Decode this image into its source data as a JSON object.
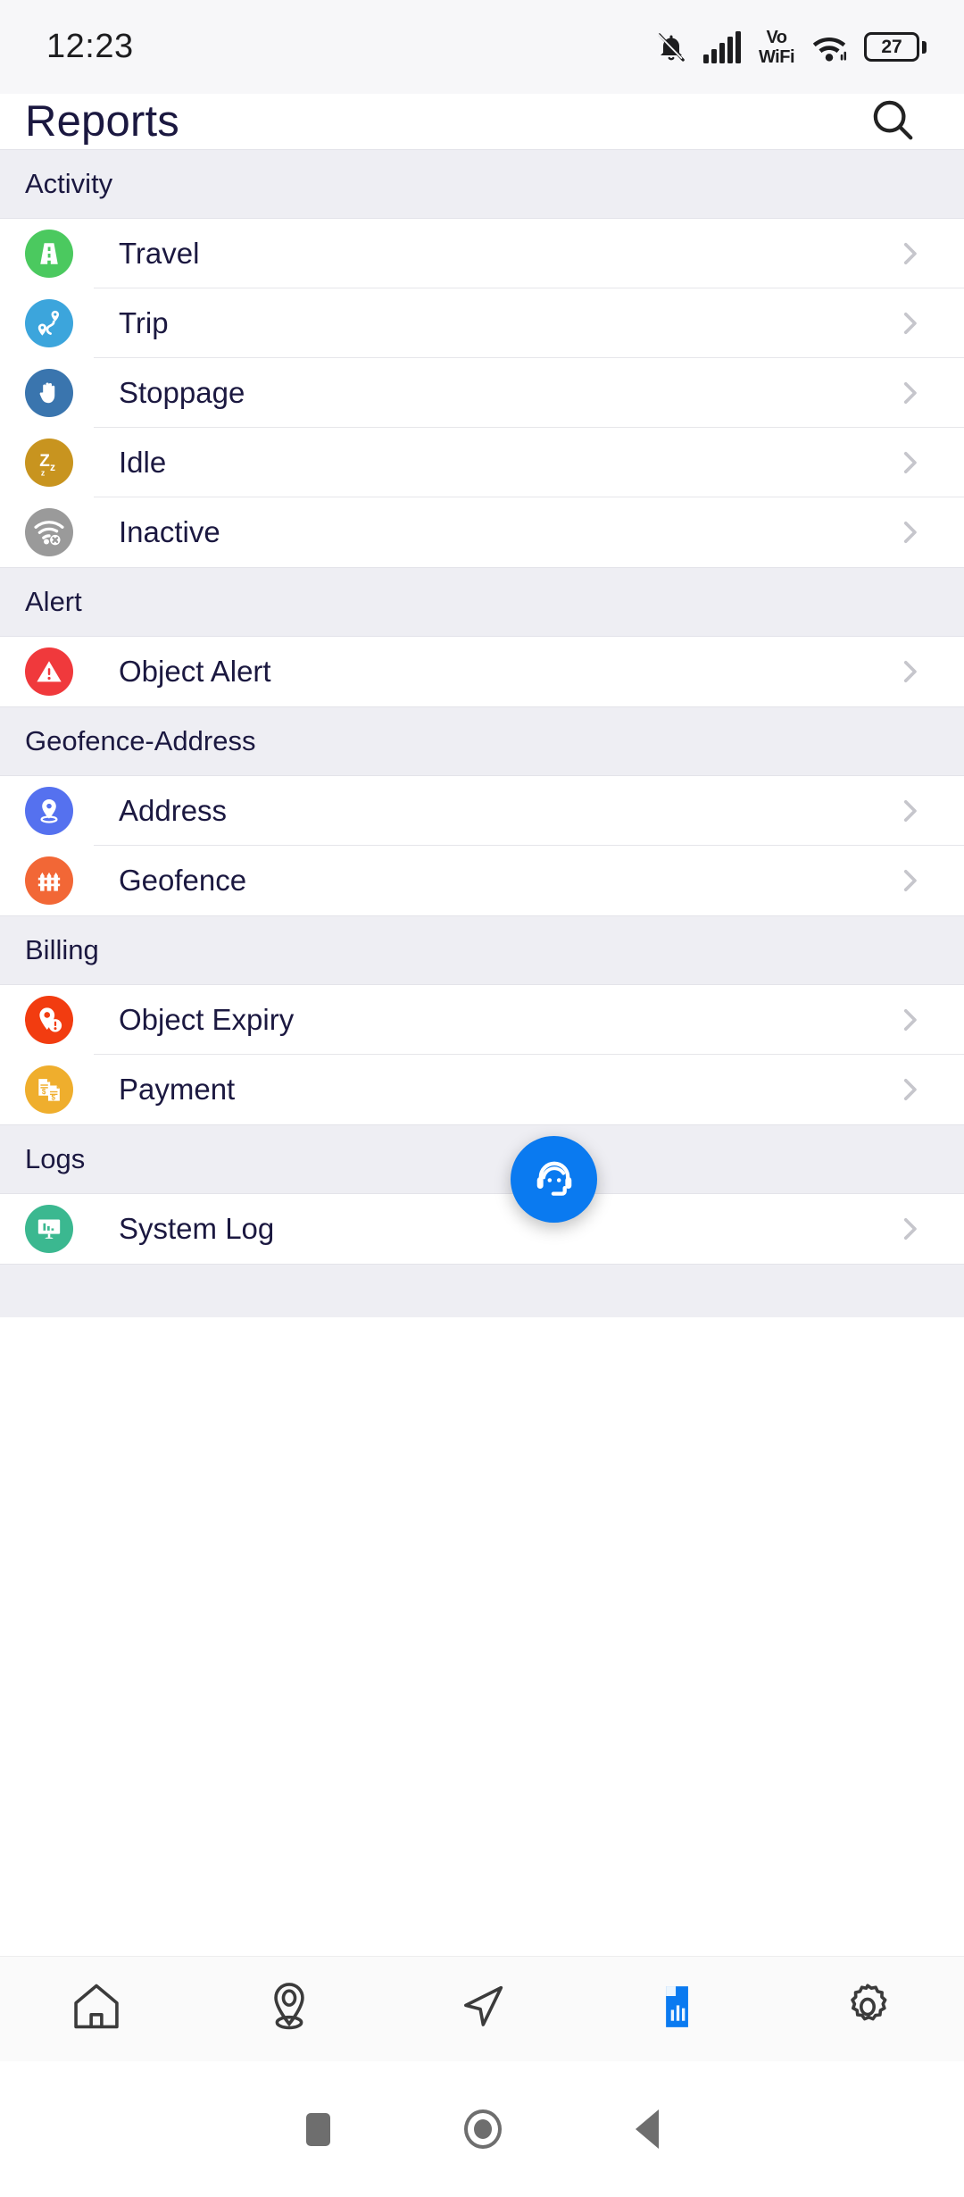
{
  "status_bar": {
    "time": "12:23",
    "vowifi_top": "Vo",
    "vowifi_bottom": "WiFi",
    "battery_level": "27",
    "icons": [
      "bell-muted-icon",
      "signal-bars-icon",
      "vowifi-icon",
      "wifi-icon",
      "battery-icon"
    ]
  },
  "app_bar": {
    "title": "Reports",
    "search_icon": "search-icon"
  },
  "sections": [
    {
      "title": "Activity",
      "items": [
        {
          "label": "Travel",
          "icon": "road-icon",
          "color": "#4bc95f"
        },
        {
          "label": "Trip",
          "icon": "route-pins-icon",
          "color": "#3ca5dc"
        },
        {
          "label": "Stoppage",
          "icon": "hand-stop-icon",
          "color": "#3a75ae"
        },
        {
          "label": "Idle",
          "icon": "sleep-zzz-icon",
          "color": "#c8941f"
        },
        {
          "label": "Inactive",
          "icon": "wifi-off-icon",
          "color": "#9a9a9a"
        }
      ]
    },
    {
      "title": "Alert",
      "items": [
        {
          "label": "Object Alert",
          "icon": "warning-triangle-icon",
          "color": "#f0393c"
        }
      ]
    },
    {
      "title": "Geofence-Address",
      "items": [
        {
          "label": "Address",
          "icon": "map-pin-icon",
          "color": "#5571ef"
        },
        {
          "label": "Geofence",
          "icon": "fence-icon",
          "color": "#f26736"
        }
      ]
    },
    {
      "title": "Billing",
      "items": [
        {
          "label": "Object Expiry",
          "icon": "pin-alert-icon",
          "color": "#f23c10"
        },
        {
          "label": "Payment",
          "icon": "invoice-icon",
          "color": "#efae2d"
        }
      ]
    },
    {
      "title": "Logs",
      "items": [
        {
          "label": "System Log",
          "icon": "monitor-chart-icon",
          "color": "#3bb890"
        }
      ]
    }
  ],
  "fab": {
    "icon": "support-headset-icon",
    "color": "#0a7af0"
  },
  "bottom_nav": {
    "active_index": 3,
    "active_color": "#0a7af0",
    "items": [
      {
        "icon": "home-icon"
      },
      {
        "icon": "location-pin-icon"
      },
      {
        "icon": "navigation-arrow-icon"
      },
      {
        "icon": "report-chart-icon"
      },
      {
        "icon": "gear-icon"
      }
    ]
  },
  "system_nav": {
    "items": [
      {
        "icon": "recents-square-icon"
      },
      {
        "icon": "home-circle-icon"
      },
      {
        "icon": "back-triangle-icon"
      }
    ]
  },
  "chevron_icon": "chevron-right-icon"
}
